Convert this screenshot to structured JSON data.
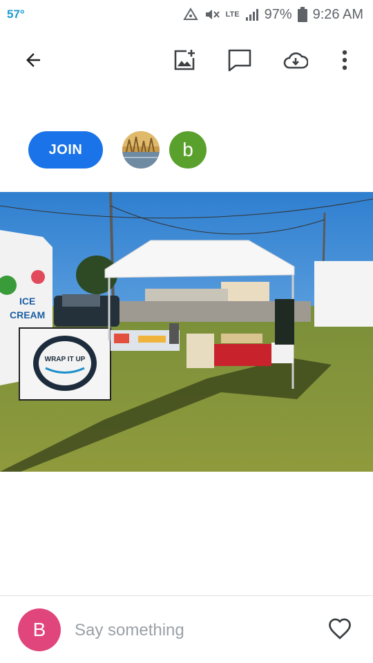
{
  "status_bar": {
    "temperature": "57°",
    "network": "LTE",
    "battery": "97%",
    "time": "9:26 AM",
    "temp_color": "#1a9bd1"
  },
  "app_bar": {
    "icons": [
      "back-arrow-icon",
      "add-photo-icon",
      "comment-icon",
      "cloud-download-icon",
      "more-vert-icon"
    ]
  },
  "album": {
    "join_label": "JOIN",
    "join_color": "#1a73e8",
    "member_avatar_letter": "b",
    "member_avatar_color": "#5aa02c"
  },
  "photo": {
    "sign_text_1": "ICE",
    "sign_text_2": "CREAM",
    "logo_text": "WRAP IT UP"
  },
  "comment_bar": {
    "user_initial": "B",
    "user_color": "#e0457b",
    "placeholder": "Say something"
  }
}
